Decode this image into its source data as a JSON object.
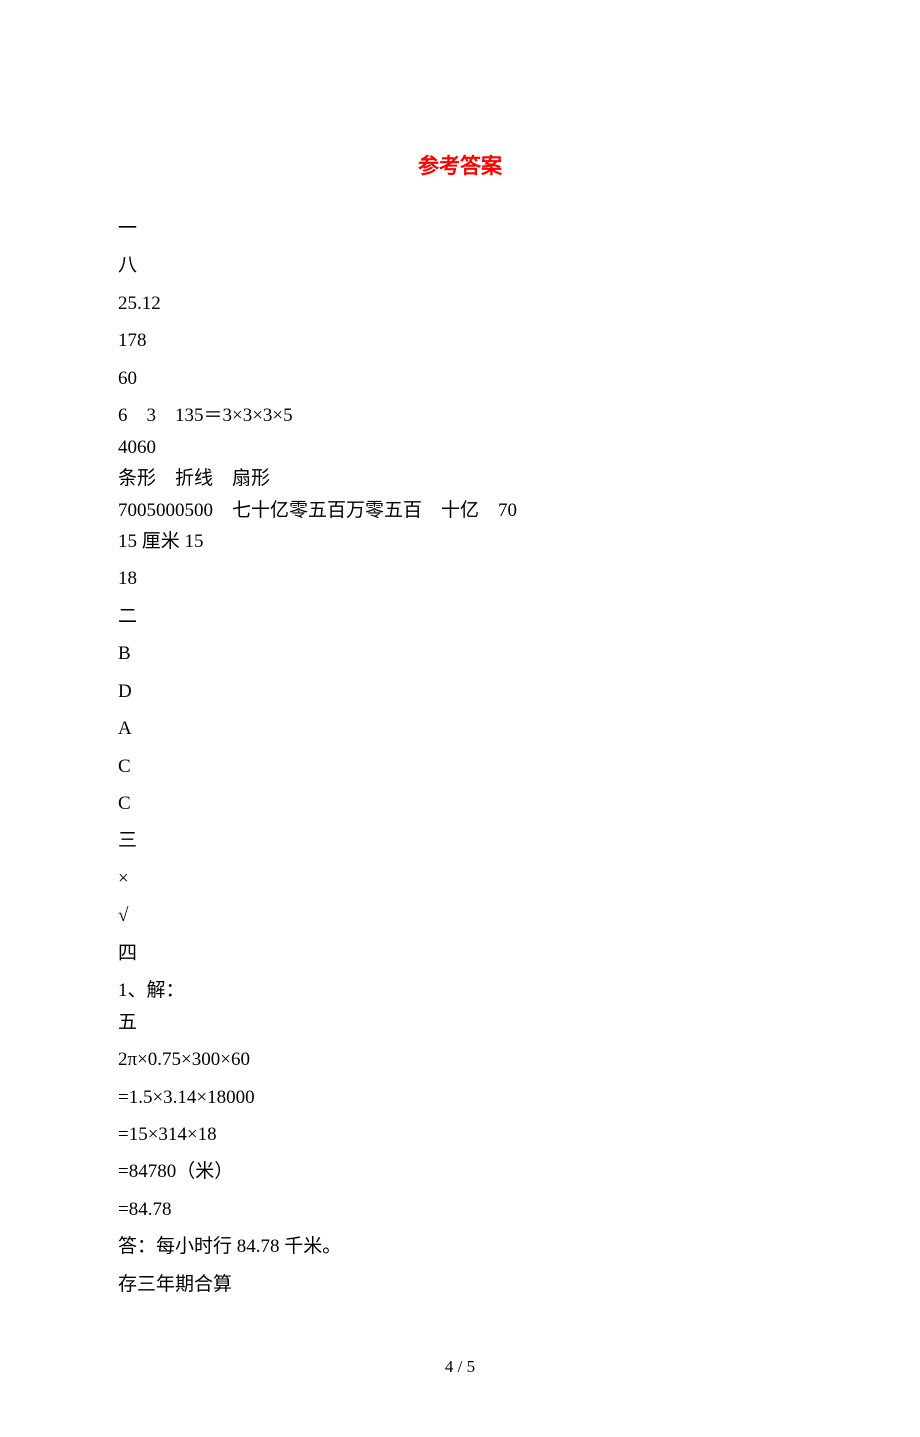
{
  "title": "参考答案",
  "lines": {
    "l1": "一",
    "l2": "八",
    "l3": "25.12",
    "l4": "178",
    "l5": "60",
    "l6": "6    3    135＝3×3×3×5",
    "l7": "4060",
    "l8": "条形    折线    扇形",
    "l9": "7005000500    七十亿零五百万零五百    十亿    70",
    "l10": "15 厘米 15",
    "l11": "18",
    "l12": "二",
    "l13": "B",
    "l14": "D",
    "l15": "A",
    "l16": "C",
    "l17": "C",
    "l18": "三",
    "l19": "×",
    "l20": "√",
    "l21": "四",
    "l22": "1、解：",
    "l23": "五",
    "l24": "2π×0.75×300×60",
    "l25": "=1.5×3.14×18000",
    "l26": "=15×314×18",
    "l27": "=84780（米）",
    "l28": "=84.78",
    "l29": "答：每小时行 84.78 千米。",
    "l30": "存三年期合算"
  },
  "pagenum": "4 / 5"
}
